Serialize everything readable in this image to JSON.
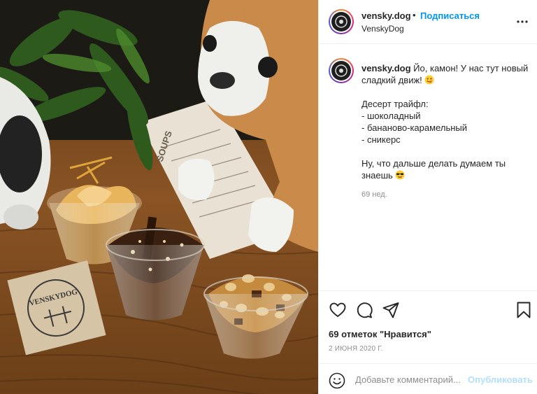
{
  "post": {
    "username": "vensky.dog",
    "follow_label": "Подписаться",
    "separator": "•",
    "subtitle": "VenskyDog",
    "caption_text": " Йо, камон! У нас тут новый сладкий движ! ",
    "caption_body": "\n\nДесерт трайфл:\n- шоколадный\n- бананово-карамельный\n- сникерс\n\nНу, что дальше делать думаем ты знаешь ",
    "caption_time": "69 нед.",
    "likes": "69 отметок \"Нравится\"",
    "date": "2 ИЮНЯ 2020 Г."
  },
  "comment": {
    "placeholder": "Добавьте комментарий...",
    "publish_label": "Опубликовать"
  },
  "photo": {
    "logo_text": "VENSKYDOG",
    "menu_text": "SOUPS"
  },
  "icons": {
    "more": "more-options-icon",
    "like": "heart-icon",
    "comment": "comment-icon",
    "share": "paper-plane-icon",
    "save": "bookmark-icon",
    "emoji": "smile-icon"
  },
  "colors": {
    "link_blue": "#0095f6",
    "publish_disabled": "#b2dffc",
    "muted": "#8e8e8e",
    "text": "#262626"
  }
}
